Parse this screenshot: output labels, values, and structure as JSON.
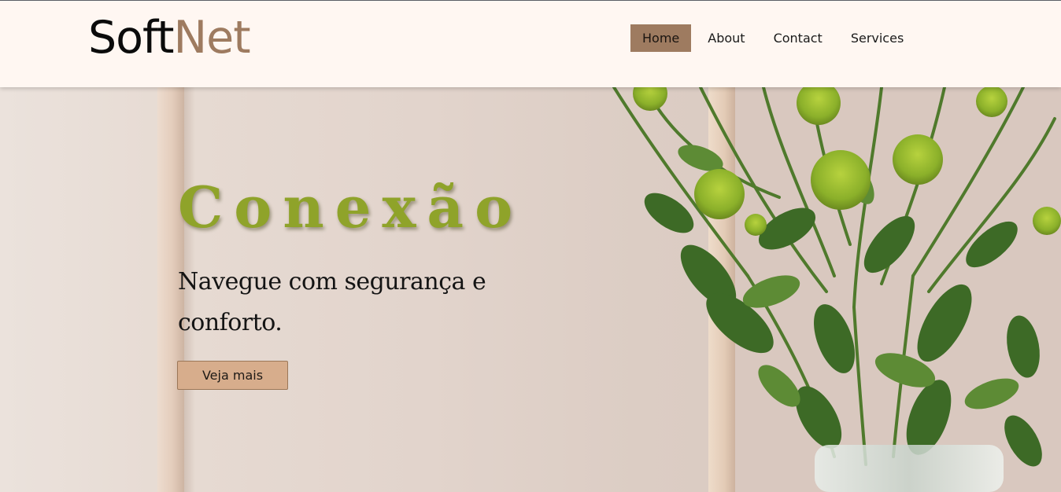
{
  "header": {
    "logo": {
      "part1": "Soft",
      "part2": "Net"
    },
    "nav": [
      {
        "label": "Home",
        "active": true
      },
      {
        "label": "About",
        "active": false
      },
      {
        "label": "Contact",
        "active": false
      },
      {
        "label": "Services",
        "active": false
      }
    ]
  },
  "hero": {
    "title": "Conexão",
    "subtitle": "Navegue com segurança e conforto.",
    "button_label": "Veja mais",
    "image": "flowers-in-vase-photo"
  },
  "colors": {
    "header_bg": "#fff7f2",
    "accent_brown": "#9e7b60",
    "title_green": "#8fa32a",
    "button_bg": "#d7ad8c"
  }
}
